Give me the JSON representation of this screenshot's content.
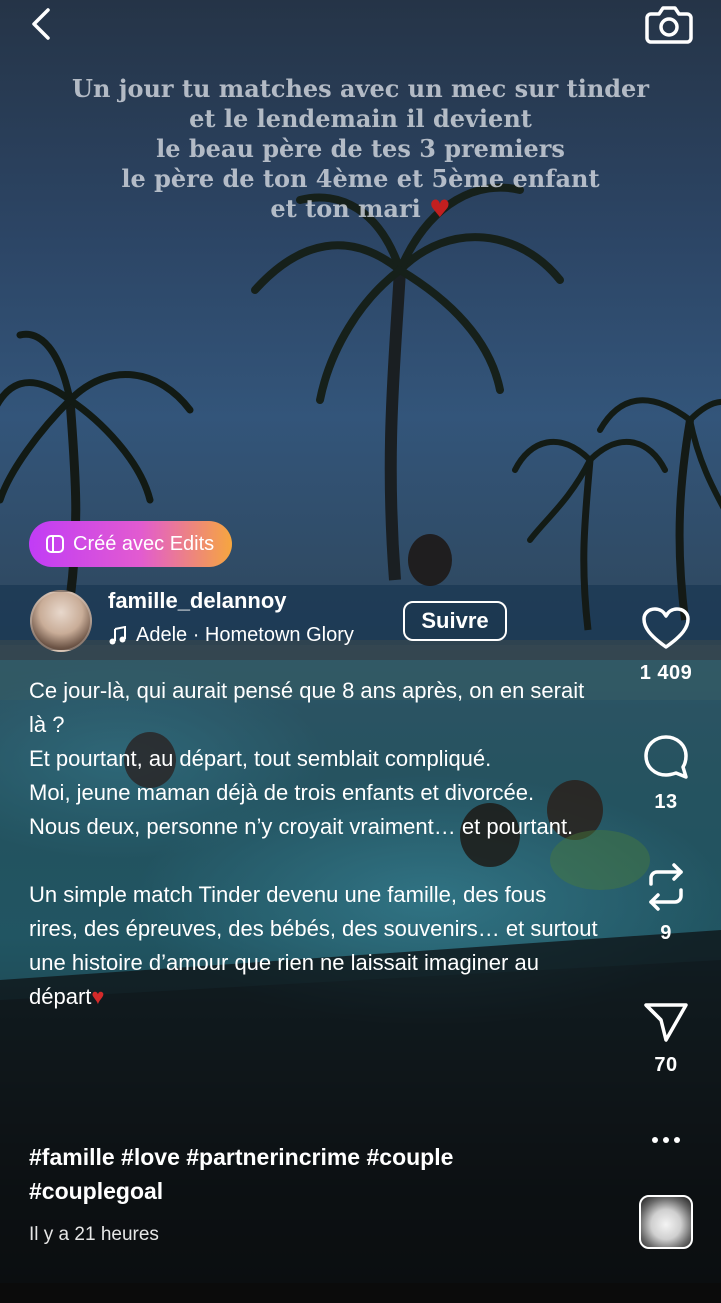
{
  "overlay_text": [
    "Un jour tu matches avec un mec sur tinder",
    "et le lendemain il devient",
    "le beau père de tes 3 premiers",
    "le père de ton 4ème et 5ème enfant",
    "et ton mari"
  ],
  "badge": {
    "label": "Créé avec Edits",
    "colors": [
      "#c13cf6",
      "#f6a63f"
    ]
  },
  "author": {
    "username": "famille_delannoy",
    "music": "Adele · Hometown Glory",
    "follow_label": "Suivre"
  },
  "caption": {
    "paragraph1": "Ce jour-là, qui aurait pensé que 8 ans après, on en serait là ?",
    "paragraph2": "Et pourtant, au départ, tout semblait compliqué.",
    "paragraph3": "Moi, jeune maman déjà de trois enfants et divorcée.",
    "paragraph4": "Nous deux, personne n’y croyait vraiment… et pourtant.",
    "paragraph5": "Un simple match Tinder devenu une famille, des fous rires, des épreuves, des bébés, des souvenirs… et surtout une histoire d’amour que rien ne laissait imaginer au départ",
    "hashtags": "#famille #love #partnerincrime #couple #couplegoal",
    "timestamp": "Il y a 21 heures"
  },
  "actions": {
    "likes": "1 409",
    "comments": "13",
    "reposts": "9",
    "shares": "70"
  },
  "icons": [
    "back-icon",
    "camera-icon",
    "heart-icon",
    "comment-icon",
    "repost-icon",
    "send-icon",
    "more-icon",
    "music-note-icon",
    "edits-icon"
  ]
}
